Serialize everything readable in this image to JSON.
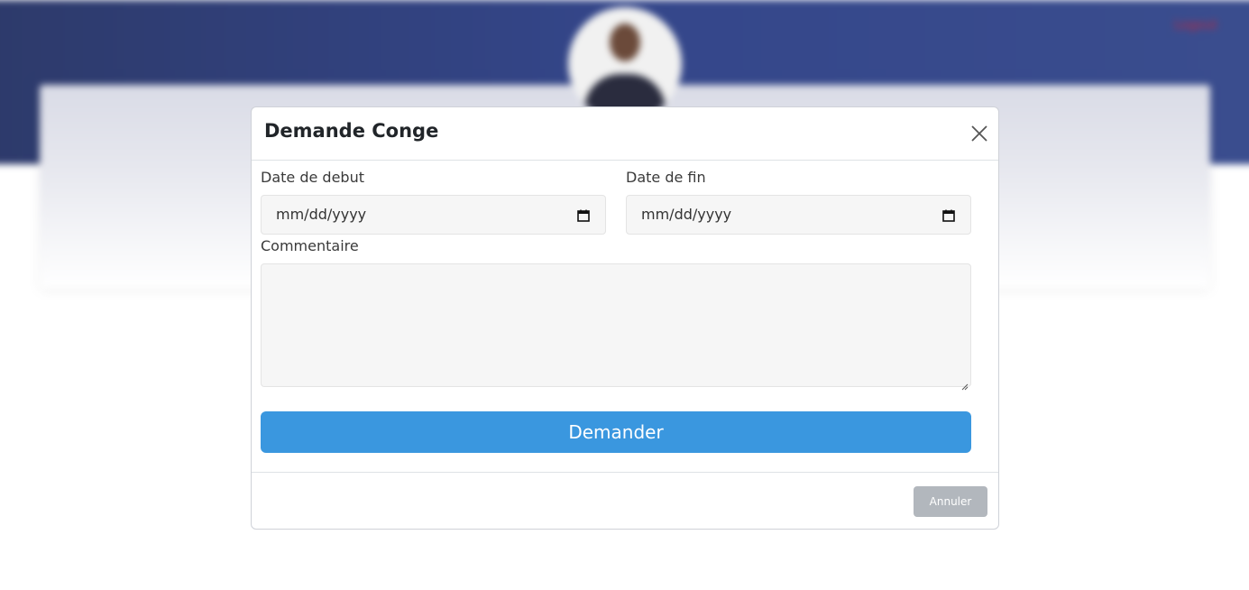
{
  "background": {
    "header_color": "#2d3a6b",
    "logout_label": "Logout"
  },
  "modal": {
    "title": "Demande Conge",
    "close_icon": "close-icon",
    "start_date": {
      "label": "Date de debut",
      "placeholder": "mm/dd/yyyy",
      "icon": "calendar-icon"
    },
    "end_date": {
      "label": "Date de fin",
      "placeholder": "mm/dd/yyyy",
      "icon": "calendar-icon"
    },
    "comment": {
      "label": "Commentaire",
      "value": ""
    },
    "submit_label": "Demander",
    "cancel_label": "Annuler",
    "accent_color": "#3a97df",
    "cancel_color": "#b2b7bd"
  }
}
